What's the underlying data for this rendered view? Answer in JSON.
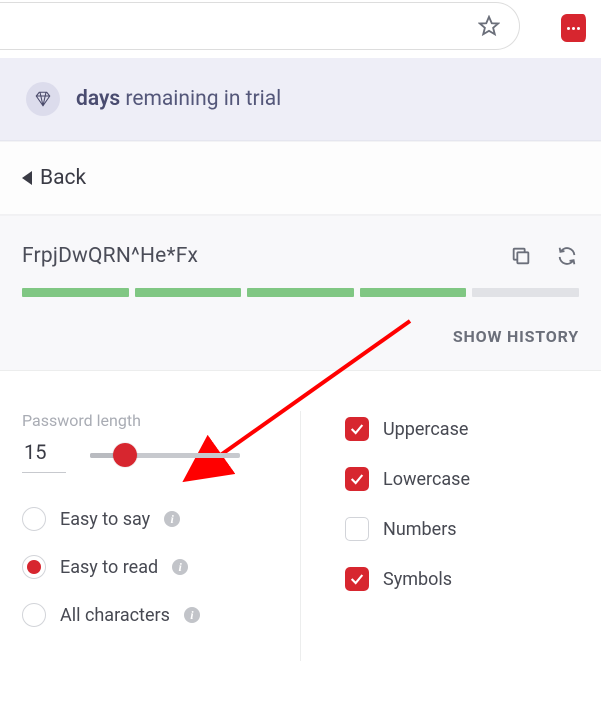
{
  "trial": {
    "bold": "days",
    "rest": "remaining in trial"
  },
  "back": {
    "label": "Back"
  },
  "password": {
    "value": "FrpjDwQRN^He*Fx"
  },
  "strength": {
    "filled": 4,
    "total": 5
  },
  "history": {
    "label": "SHOW HISTORY"
  },
  "length": {
    "label": "Password length",
    "value": "15",
    "slider_percent": 23
  },
  "modes": {
    "items": [
      {
        "label": "Easy to say",
        "selected": false
      },
      {
        "label": "Easy to read",
        "selected": true
      },
      {
        "label": "All characters",
        "selected": false
      }
    ]
  },
  "charsets": {
    "items": [
      {
        "label": "Uppercase",
        "checked": true
      },
      {
        "label": "Lowercase",
        "checked": true
      },
      {
        "label": "Numbers",
        "checked": false
      },
      {
        "label": "Symbols",
        "checked": true
      }
    ]
  },
  "colors": {
    "accent": "#d7262f",
    "success": "#80c783"
  }
}
